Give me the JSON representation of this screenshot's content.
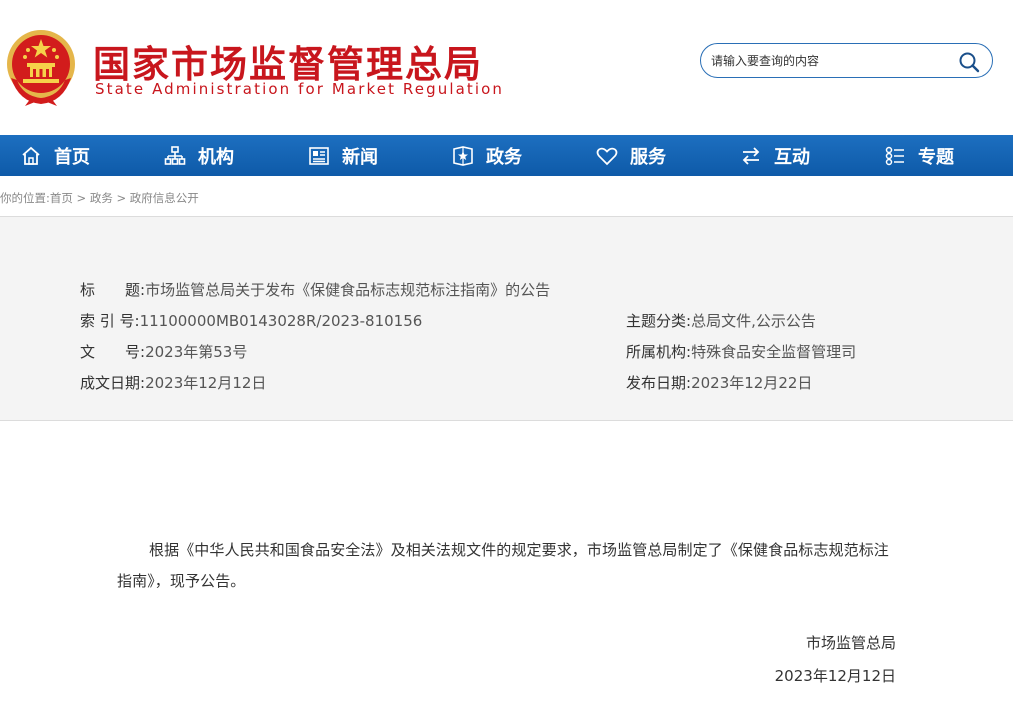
{
  "header": {
    "site_title": "国家市场监督管理总局",
    "site_subtitle": "State Administration for Market Regulation",
    "search_placeholder": "请输入要查询的内容"
  },
  "nav": [
    {
      "label": "首页",
      "icon": "home-icon"
    },
    {
      "label": "机构",
      "icon": "org-icon"
    },
    {
      "label": "新闻",
      "icon": "news-icon"
    },
    {
      "label": "政务",
      "icon": "affairs-icon"
    },
    {
      "label": "服务",
      "icon": "heart-icon"
    },
    {
      "label": "互动",
      "icon": "exchange-icon"
    },
    {
      "label": "专题",
      "icon": "topic-icon"
    }
  ],
  "breadcrumb": {
    "prefix": "你的位置:",
    "items": [
      "首页",
      "政务",
      "政府信息公开"
    ],
    "sep": ">"
  },
  "info": {
    "title_key": "标　　题:",
    "title_val": "市场监管总局关于发布《保健食品标志规范标注指南》的公告",
    "index_key": "索 引 号:",
    "index_val": "11100000MB0143028R/2023-810156",
    "category_key": "主题分类:",
    "category_val": "总局文件,公示公告",
    "docno_key": "文　　号:",
    "docno_val": "2023年第53号",
    "org_key": "所属机构:",
    "org_val": "特殊食品安全监督管理司",
    "created_key": "成文日期:",
    "created_val": "2023年12月12日",
    "published_key": "发布日期:",
    "published_val": "2023年12月22日"
  },
  "article": {
    "body": "根据《中华人民共和国食品安全法》及相关法规文件的规定要求，市场监管总局制定了《保健食品标志规范标注指南》，现予公告。",
    "signature": "市场监管总局",
    "date": "2023年12月12日"
  },
  "colors": {
    "brand_red": "#c8161d",
    "nav_blue": "#1565b5",
    "info_bg": "#f4f4f4"
  }
}
